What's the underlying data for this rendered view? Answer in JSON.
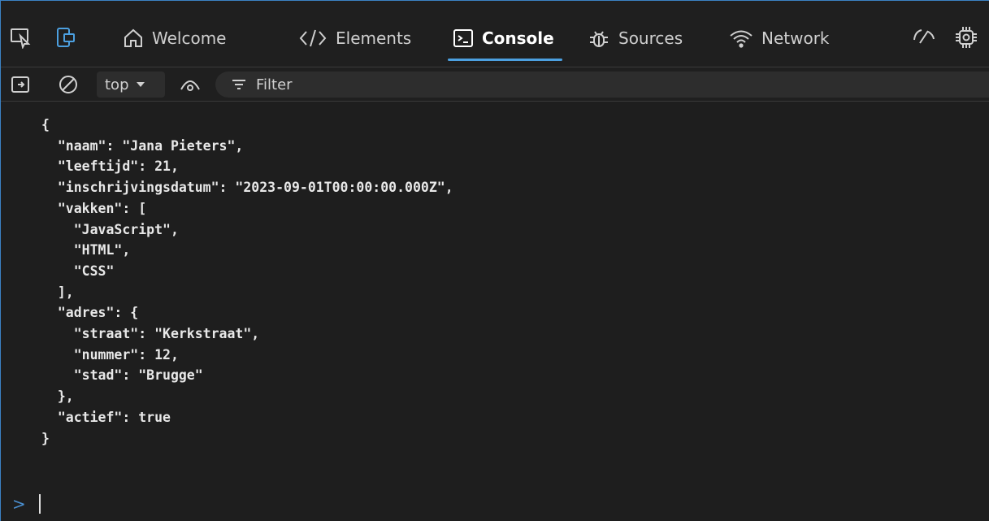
{
  "tabs": [
    {
      "label": "Welcome",
      "icon": "home-icon",
      "active": false
    },
    {
      "label": "Elements",
      "icon": "code-brackets-icon",
      "active": false
    },
    {
      "label": "Console",
      "icon": "console-icon",
      "active": true
    },
    {
      "label": "Sources",
      "icon": "bug-icon",
      "active": false
    },
    {
      "label": "Network",
      "icon": "wifi-icon",
      "active": false
    }
  ],
  "toolbar": {
    "context": "top",
    "filter_placeholder": "Filter"
  },
  "console": {
    "json_lines": [
      "{",
      "  \"naam\": \"Jana Pieters\",",
      "  \"leeftijd\": 21,",
      "  \"inschrijvingsdatum\": \"2023-09-01T00:00:00.000Z\",",
      "  \"vakken\": [",
      "    \"JavaScript\",",
      "    \"HTML\",",
      "    \"CSS\"",
      "  ],",
      "  \"adres\": {",
      "    \"straat\": \"Kerkstraat\",",
      "    \"nummer\": 12,",
      "    \"stad\": \"Brugge\"",
      "  },",
      "  \"actief\": true",
      "}"
    ],
    "prompt_symbol": ">"
  },
  "colors": {
    "accent": "#4ca0e0",
    "background": "#1e1e1e",
    "panel": "#1f1f1f"
  }
}
